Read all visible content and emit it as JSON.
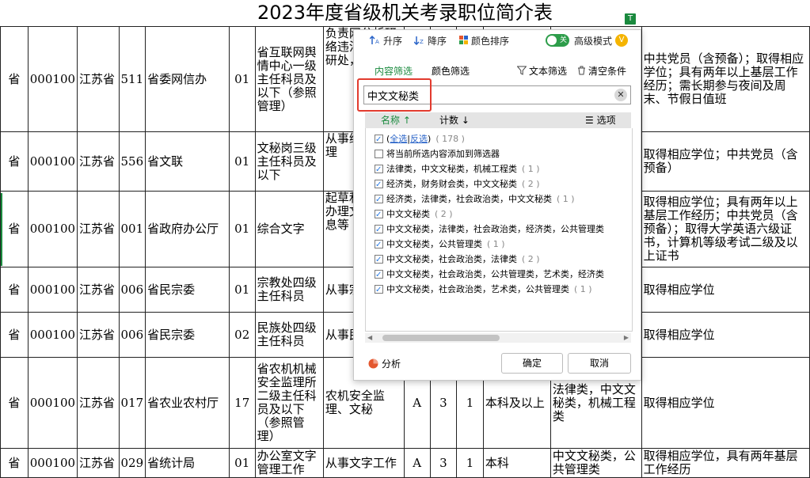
{
  "sheet": {
    "title": "2023年度省级机关考录职位简介表",
    "rows": [
      {
        "level": "省",
        "code": "000100",
        "prov": "江苏省",
        "dept_code": "511",
        "dept": "省委网信办",
        "pos_code": "01",
        "pos_name": "省互联网舆情中心一级主任科员及以下（参照管理）",
        "desc": "负责网分析研络违法信息举研处，合文字",
        "type": "",
        "exam": "",
        "num": "",
        "edu": "",
        "major": "",
        "req": "中共党员（含预备）；取得相应学位；具有两年以上基层工作经历；需长期参与夜间及周末、节假日值班"
      },
      {
        "level": "省",
        "code": "000100",
        "prov": "江苏省",
        "dept_code": "556",
        "dept": "省文联",
        "pos_code": "01",
        "pos_name": "文秘岗三级主任科员及以下",
        "desc": "从事综工作、理",
        "type": "",
        "exam": "",
        "num": "",
        "edu": "",
        "major": "",
        "req": "取得相应学位；中共党员（含预备）"
      },
      {
        "level": "省",
        "code": "000100",
        "prov": "江苏省",
        "dept_code": "001",
        "dept": "省政府办公厅",
        "pos_code": "01",
        "pos_name": "综合文字",
        "desc": "起草和关文字办理文务、督息等",
        "type": "",
        "exam": "",
        "num": "",
        "edu": "",
        "major": "",
        "req": "取得相应学位；具有两年以上基层工作经历；中共党员（含预备）；取得大学英语六级证书，计算机等级考试二级及以上证书"
      },
      {
        "level": "省",
        "code": "000100",
        "prov": "江苏省",
        "dept_code": "006",
        "dept": "省民宗委",
        "pos_code": "01",
        "pos_name": "宗教处四级主任科员",
        "desc": "从事宗",
        "type": "",
        "exam": "",
        "num": "",
        "edu": "",
        "major": "",
        "req": "取得相应学位"
      },
      {
        "level": "省",
        "code": "000100",
        "prov": "江苏省",
        "dept_code": "006",
        "dept": "省民宗委",
        "pos_code": "02",
        "pos_name": "民族处四级主任科员",
        "desc": "从事民",
        "type": "",
        "exam": "",
        "num": "",
        "edu": "",
        "major": "",
        "req": "取得相应学位"
      },
      {
        "level": "省",
        "code": "000100",
        "prov": "江苏省",
        "dept_code": "017",
        "dept": "省农业农村厅",
        "pos_code": "17",
        "pos_name": "省农机机械安全监理所二级主任科员及以下（参照管理）",
        "desc": "农机安全监理、文秘",
        "type": "A",
        "exam": "3",
        "num": "1",
        "edu": "本科及以上",
        "major": "法律类，中文文秘类，机械工程类",
        "req": "取得相应学位"
      },
      {
        "level": "省",
        "code": "000100",
        "prov": "江苏省",
        "dept_code": "029",
        "dept": "省统计局",
        "pos_code": "01",
        "pos_name": "办公室文字管理工作",
        "desc": "从事文字工作",
        "type": "A",
        "exam": "3",
        "num": "1",
        "edu": "本科",
        "major": "中文文秘类，公共管理类",
        "req": "取得相应学位，具有两年基层工作经历"
      }
    ]
  },
  "filter_tag": "T",
  "dialog": {
    "toolbar": {
      "asc": "升序",
      "desc": "降序",
      "color_sort": "颜色排序",
      "toggle_text": "关",
      "advanced": "高级模式",
      "crown": "V"
    },
    "tabs": {
      "content": "内容筛选",
      "color": "颜色筛选",
      "text_filter": "文本筛选",
      "clear": "清空条件"
    },
    "search_value": "中文文秘类",
    "list_header": {
      "name": "名称",
      "count": "计数",
      "options": "选项"
    },
    "select_all": {
      "all": "全选",
      "invert": "反选",
      "count": "178"
    },
    "add_current": "将当前所选内容添加到筛选器",
    "items": [
      {
        "label": "法律类，中文文秘类，机械工程类",
        "count": "1"
      },
      {
        "label": "经济类，财务财会类，中文文秘类",
        "count": "2"
      },
      {
        "label": "经济类，法律类，社会政治类，中文文秘类",
        "count": "1"
      },
      {
        "label": "中文文秘类",
        "count": "2"
      },
      {
        "label": "中文文秘类，法律类，社会政治类，经济类，公共管理类",
        "count": ""
      },
      {
        "label": "中文文秘类，公共管理类",
        "count": "1"
      },
      {
        "label": "中文文秘类，社会政治类，法律类",
        "count": "2"
      },
      {
        "label": "中文文秘类，社会政治类，公共管理类，艺术类，经济类",
        "count": ""
      },
      {
        "label": "中文文秘类，社会政治类，艺术类，公共管理类",
        "count": "1"
      }
    ],
    "analyze": "分析",
    "ok": "确定",
    "cancel": "取消"
  }
}
